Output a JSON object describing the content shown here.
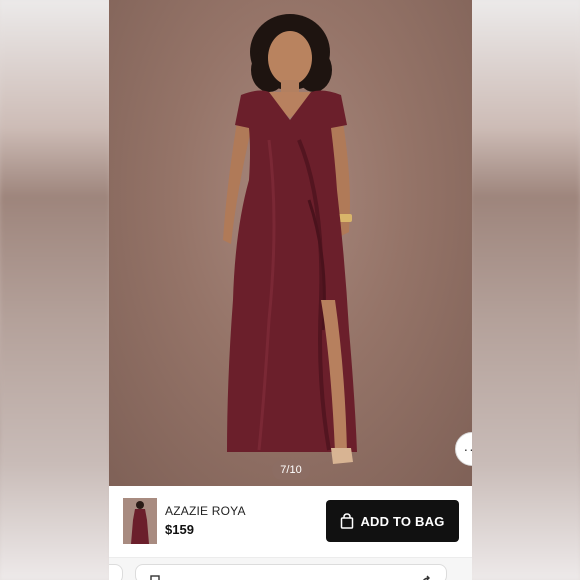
{
  "gallery": {
    "counter": "7/10",
    "more_icon": "ellipsis-icon"
  },
  "product": {
    "name": "AZAZIE ROYA",
    "price": "$159",
    "add_to_bag": "ADD TO BAG",
    "bag_icon": "shopping-bag-icon"
  },
  "colors": {
    "dress": "#6b1f2b",
    "backdrop": "#957468",
    "button": "#111111"
  }
}
